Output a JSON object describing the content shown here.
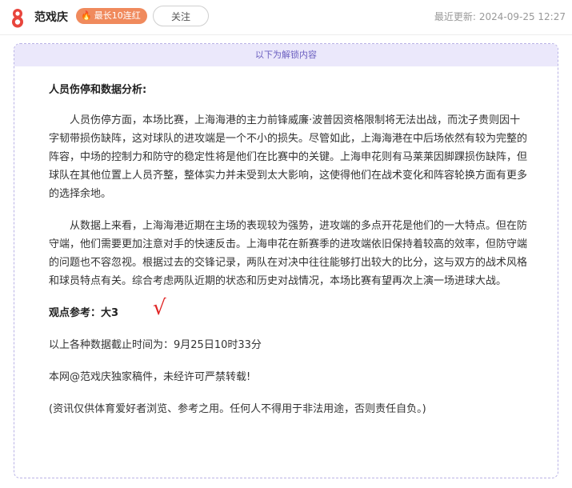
{
  "header": {
    "author": "范戏庆",
    "badge": "最长10连红",
    "follow_label": "关注",
    "updated_label": "最近更新:",
    "updated_date": "2024-09-25 12:27"
  },
  "unlock_banner": "以下为解锁内容",
  "content": {
    "section_title": "人员伤停和数据分析:",
    "para1": "人员伤停方面，本场比赛，上海海港的主力前锋威廉·波普因资格限制将无法出战，而沈子贵则因十字韧带损伤缺阵，这对球队的进攻端是一个不小的损失。尽管如此，上海海港在中后场依然有较为完整的阵容，中场的控制力和防守的稳定性将是他们在比赛中的关键。上海申花则有马莱莱因脚踝损伤缺阵，但球队在其他位置上人员齐整，整体实力并未受到太大影响，这使得他们在战术变化和阵容轮换方面有更多的选择余地。",
    "para2": "从数据上来看，上海海港近期在主场的表现较为强势，进攻端的多点开花是他们的一大特点。但在防守端，他们需要更加注意对手的快速反击。上海申花在新赛季的进攻端依旧保持着较高的效率，但防守端的问题也不容忽视。根据过去的交锋记录，两队在对决中往往能够打出较大的比分，这与双方的战术风格和球员特点有关。综合考虑两队近期的状态和历史对战情况，本场比赛有望再次上演一场进球大战。",
    "viewpoint": "观点参考：大3",
    "check_mark": "√",
    "data_cutoff": "以上各种数据截止时间为：9月25日10时33分",
    "copyright": "本网@范戏庆独家稿件，未经许可严禁转载!",
    "disclaimer": "(资讯仅供体育爱好者浏览、参考之用。任何人不得用于非法用途，否则责任自负。)"
  },
  "colors": {
    "badge": "#f08a5d",
    "logo": "#e8453c",
    "unlock_bar_bg": "#ebe8fb",
    "unlock_border": "#b9b3e6",
    "check": "#e02424"
  }
}
